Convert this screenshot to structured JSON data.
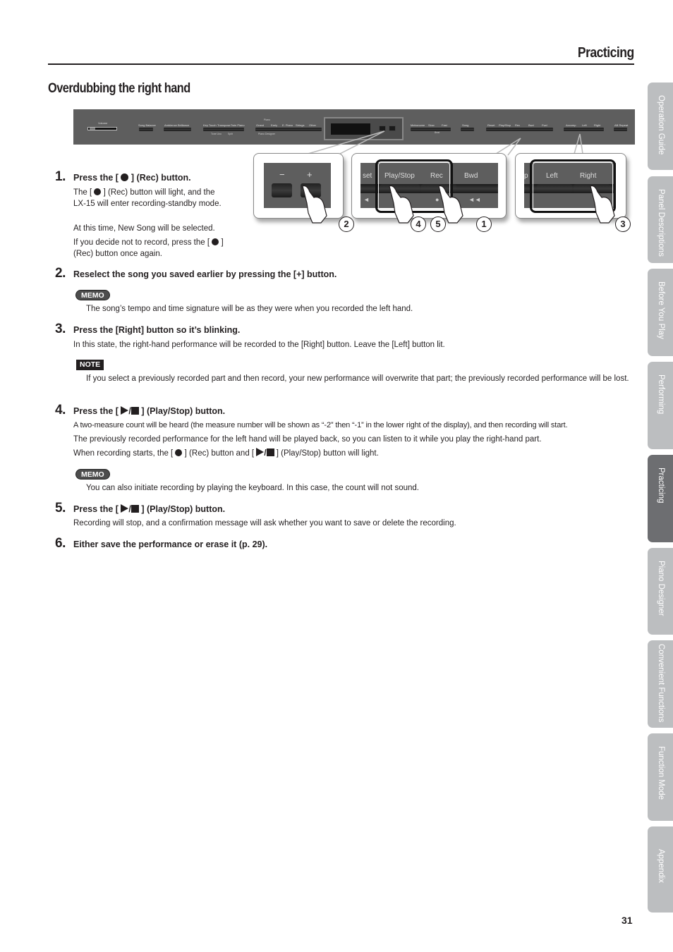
{
  "header": {
    "section_title": "Practicing"
  },
  "page": {
    "title": "Overdubbing the right hand",
    "number": "31"
  },
  "panel": {
    "labels": {
      "volume": "Volume",
      "song_balance": "Song Balance",
      "ambience": "Ambience",
      "brilliance": "Brilliance",
      "key_touch": "Key Touch",
      "transpose": "Transpose",
      "twin_piano": "Twin Piano",
      "piano_group": "Piano",
      "grand": "Grand",
      "early": "Early",
      "e_piano": "E. Piano",
      "strings": "Strings",
      "other": "Other",
      "twin_one": "Tone Uno",
      "split": "Split",
      "piano_designer": "Piano Designer",
      "minus": "−",
      "plus": "+",
      "metronome": "Metronome",
      "slow": "Slow",
      "fast": "Fast",
      "beat": "Beat",
      "song": "Song",
      "reset": "Reset",
      "play_stop": "Play/Stop",
      "rec": "Rec",
      "bwd": "Bwd",
      "fwd": "Fwd",
      "accomp": "Accomp",
      "left": "Left",
      "right": "Right",
      "ab_repeat": "AB Repeat"
    }
  },
  "zoom_callouts": {
    "box1": {
      "minus": "−",
      "plus": "+"
    },
    "box2": {
      "reset_partial": "set",
      "play_stop": "Play/Stop",
      "rec": "Rec",
      "bwd": "Bwd",
      "play_symbol": "►/■",
      "rec_symbol": "●",
      "bwd_symbol": "◄◄",
      "reset_symbol": "◄"
    },
    "box3": {
      "accomp_partial": "p",
      "left": "Left",
      "right": "Right"
    },
    "step_markers": [
      "2",
      "4",
      "5",
      "1",
      "3"
    ]
  },
  "steps": [
    {
      "num": "1.",
      "head_pre": "Press the [",
      "head_post": "] (Rec) button.",
      "lines": [
        {
          "pre": "The [",
          "post": "] (Rec) button will light, and the LX-15 will enter recording-standby mode."
        },
        {
          "text": "At this time, New Song will be selected."
        },
        {
          "pre": "If you decide not to record, press the [",
          "post": "] (Rec) button once again."
        }
      ]
    },
    {
      "num": "2.",
      "head": "Reselect the song you saved earlier by pressing the [+] button."
    },
    {
      "num": "3.",
      "head": "Press the [Right] button so it’s blinking.",
      "body": "In this state, the right-hand performance will be recorded to the [Right] button. Leave the [Left] button lit."
    },
    {
      "num": "4.",
      "head_pre": "Press the [",
      "head_post": "] (Play/Stop) button.",
      "body1": "A two-measure count will be heard (the measure number will be shown as “-2” then “-1” in the lower right of the display), and then recording will start.",
      "body2": "The previously recorded performance for the left hand will be played back, so you can listen to it while you play the right-hand part.",
      "body3_a": "When recording starts, the [",
      "body3_b": "] (Rec) button and [",
      "body3_c": "] (Play/Stop) button will light."
    },
    {
      "num": "5.",
      "head_pre": "Press the [",
      "head_post": "] (Play/Stop) button.",
      "body": "Recording will stop, and a confirmation message will ask whether you want to save or delete the recording."
    },
    {
      "num": "6.",
      "head": "Either save the performance or erase it (p. 29)."
    }
  ],
  "memos": [
    {
      "badge": "MEMO",
      "text": "The song’s tempo and time signature will be as they were when you recorded the left hand."
    },
    {
      "badge": "MEMO",
      "text": "You can also initiate recording by playing the keyboard. In this case, the count will not sound."
    }
  ],
  "note": {
    "badge": "NOTE",
    "text": "If you select a previously recorded part and then record, your new performance will overwrite that part; the previously recorded performance will be lost."
  },
  "side_tabs": [
    {
      "label": "Operation Guide",
      "active": false
    },
    {
      "label": "Panel Descriptions",
      "active": false
    },
    {
      "label": "Before You Play",
      "active": false
    },
    {
      "label": "Performing",
      "active": false
    },
    {
      "label": "Practicing",
      "active": true
    },
    {
      "label": "Piano Designer",
      "active": false
    },
    {
      "label": "Convenient Functions",
      "active": false
    },
    {
      "label": "Function Mode",
      "active": false
    },
    {
      "label": "Appendix",
      "active": false
    }
  ],
  "colors": {
    "tab_inactive": "#bcbec0",
    "tab_active": "#6d6e71",
    "panel": "#5e5e5e",
    "text": "#231f20"
  }
}
